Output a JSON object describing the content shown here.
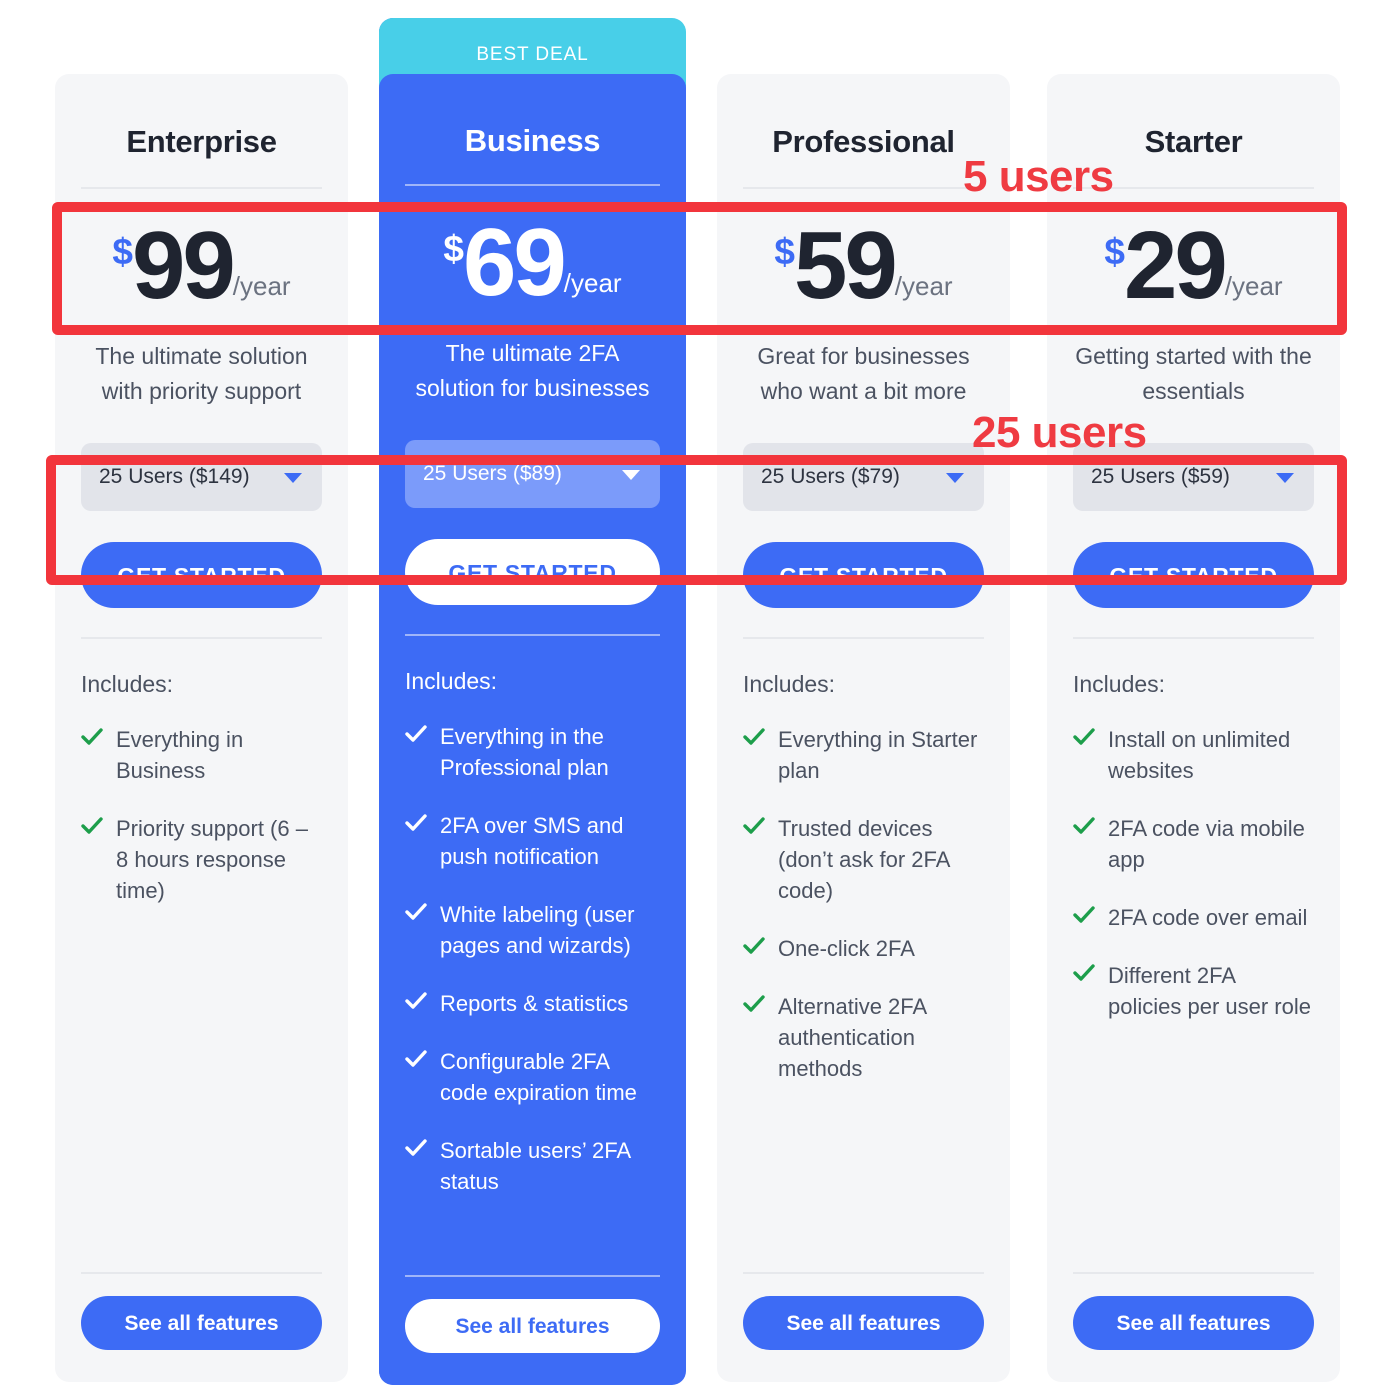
{
  "annotations": [
    {
      "id": "users-5",
      "label": "5 users",
      "color": "#ef3b42",
      "target": "price-row"
    },
    {
      "id": "users-25",
      "label": "25 users",
      "color": "#ef3b42",
      "target": "user-count-select"
    }
  ],
  "colors": {
    "brand_blue": "#3d6bf5",
    "ribbon_cyan": "#48cfe8",
    "card_bg": "#f5f6f8",
    "featured_select_bg": "#7b9bfa",
    "select_bg": "#e2e4ea",
    "check_green": "#1d9e4b",
    "check_white": "#ffffff",
    "annotation_red": "#ef3b42",
    "heading_text": "#1f2430",
    "body_text": "#4b5261"
  },
  "icons": {
    "caret": "chevron-down-icon",
    "check": "check-icon"
  },
  "plans": [
    {
      "name": "Enterprise",
      "featured": false,
      "ribbon": null,
      "currency": "$",
      "price": "99",
      "period": "/year",
      "tagline": "The ultimate solution with priority support",
      "select_value": "25 Users ($149)",
      "cta_label": "GET STARTED",
      "includes_label": "Includes:",
      "features": [
        "Everything in Business",
        "Priority support (6 – 8 hours response time)"
      ],
      "see_all_label": "See all features"
    },
    {
      "name": "Business",
      "featured": true,
      "ribbon": "BEST DEAL",
      "currency": "$",
      "price": "69",
      "period": "/year",
      "tagline": "The ultimate 2FA solution for businesses",
      "select_value": "25 Users ($89)",
      "cta_label": "GET STARTED",
      "includes_label": "Includes:",
      "features": [
        "Everything in the Professional plan",
        "2FA over SMS and push notification",
        "White labeling (user pages and wizards)",
        "Reports & statistics",
        "Configurable 2FA code expiration time",
        "Sortable users’ 2FA status"
      ],
      "see_all_label": "See all features"
    },
    {
      "name": "Professional",
      "featured": false,
      "ribbon": null,
      "currency": "$",
      "price": "59",
      "period": "/year",
      "tagline": "Great for businesses who want a bit more",
      "select_value": "25 Users ($79)",
      "cta_label": "GET STARTED",
      "includes_label": "Includes:",
      "features": [
        "Everything in Starter plan",
        "Trusted devices (don’t ask for 2FA code)",
        "One-click 2FA",
        "Alternative 2FA authentication methods"
      ],
      "see_all_label": "See all features"
    },
    {
      "name": "Starter",
      "featured": false,
      "ribbon": null,
      "currency": "$",
      "price": "29",
      "period": "/year",
      "tagline": "Getting started with the essentials",
      "select_value": "25 Users ($59)",
      "cta_label": "GET STARTED",
      "includes_label": "Includes:",
      "features": [
        "Install on unlimited websites",
        "2FA code via mobile app",
        "2FA code over email",
        "Different 2FA policies per user role"
      ],
      "see_all_label": "See all features"
    }
  ]
}
